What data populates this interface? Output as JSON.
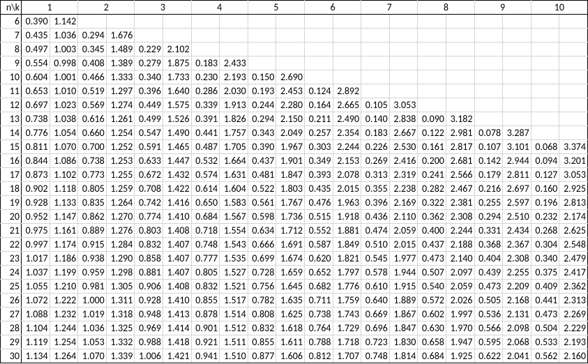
{
  "chart_data": {
    "type": "table",
    "title": "",
    "xlabel": "",
    "ylabel": "",
    "corner_label": "n\\k",
    "k_headers": [
      "1",
      "2",
      "3",
      "4",
      "5",
      "6",
      "7",
      "8",
      "9",
      "10"
    ],
    "n_values": [
      6,
      7,
      8,
      9,
      10,
      11,
      12,
      13,
      14,
      15,
      16,
      17,
      18,
      19,
      20,
      21,
      22,
      23,
      24,
      25,
      26,
      27,
      28,
      29,
      30
    ],
    "rows": [
      {
        "n": "6",
        "cells": [
          "0.390",
          "1.142",
          "",
          "",
          "",
          "",
          "",
          "",
          "",
          "",
          "",
          "",
          "",
          "",
          "",
          "",
          "",
          "",
          "",
          ""
        ]
      },
      {
        "n": "7",
        "cells": [
          "0.435",
          "1.036",
          "0.294",
          "1.676",
          "",
          "",
          "",
          "",
          "",
          "",
          "",
          "",
          "",
          "",
          "",
          "",
          "",
          "",
          "",
          ""
        ]
      },
      {
        "n": "8",
        "cells": [
          "0.497",
          "1.003",
          "0.345",
          "1.489",
          "0.229",
          "2.102",
          "",
          "",
          "",
          "",
          "",
          "",
          "",
          "",
          "",
          "",
          "",
          "",
          "",
          ""
        ]
      },
      {
        "n": "9",
        "cells": [
          "0.554",
          "0.998",
          "0.408",
          "1.389",
          "0.279",
          "1.875",
          "0.183",
          "2.433",
          "",
          "",
          "",
          "",
          "",
          "",
          "",
          "",
          "",
          "",
          "",
          ""
        ]
      },
      {
        "n": "10",
        "cells": [
          "0.604",
          "1.001",
          "0.466",
          "1.333",
          "0.340",
          "1.733",
          "0.230",
          "2.193",
          "0.150",
          "2.690",
          "",
          "",
          "",
          "",
          "",
          "",
          "",
          "",
          "",
          ""
        ]
      },
      {
        "n": "11",
        "cells": [
          "0.653",
          "1.010",
          "0.519",
          "1.297",
          "0.396",
          "1.640",
          "0.286",
          "2.030",
          "0.193",
          "2.453",
          "0.124",
          "2.892",
          "",
          "",
          "",
          "",
          "",
          "",
          "",
          ""
        ]
      },
      {
        "n": "12",
        "cells": [
          "0.697",
          "1.023",
          "0.569",
          "1.274",
          "0.449",
          "1.575",
          "0.339",
          "1.913",
          "0.244",
          "2.280",
          "0.164",
          "2.665",
          "0.105",
          "3.053",
          "",
          "",
          "",
          "",
          "",
          ""
        ]
      },
      {
        "n": "13",
        "cells": [
          "0.738",
          "1.038",
          "0.616",
          "1.261",
          "0.499",
          "1.526",
          "0.391",
          "1.826",
          "0.294",
          "2.150",
          "0.211",
          "2.490",
          "0.140",
          "2.838",
          "0.090",
          "3.182",
          "",
          "",
          "",
          ""
        ]
      },
      {
        "n": "14",
        "cells": [
          "0.776",
          "1.054",
          "0.660",
          "1.254",
          "0.547",
          "1.490",
          "0.441",
          "1.757",
          "0.343",
          "2.049",
          "0.257",
          "2.354",
          "0.183",
          "2.667",
          "0.122",
          "2.981",
          "0.078",
          "3.287",
          "",
          ""
        ]
      },
      {
        "n": "15",
        "cells": [
          "0.811",
          "1.070",
          "0.700",
          "1.252",
          "0.591",
          "1.465",
          "0.487",
          "1.705",
          "0.390",
          "1.967",
          "0.303",
          "2.244",
          "0.226",
          "2.530",
          "0.161",
          "2.817",
          "0.107",
          "3.101",
          "0.068",
          "3.374"
        ]
      },
      {
        "n": "16",
        "cells": [
          "0.844",
          "1.086",
          "0.738",
          "1.253",
          "0.633",
          "1.447",
          "0.532",
          "1.664",
          "0.437",
          "1.901",
          "0.349",
          "2.153",
          "0.269",
          "2.416",
          "0.200",
          "2.681",
          "0.142",
          "2.944",
          "0.094",
          "3.201"
        ]
      },
      {
        "n": "17",
        "cells": [
          "0.873",
          "1.102",
          "0.773",
          "1.255",
          "0.672",
          "1.432",
          "0.574",
          "1.631",
          "0.481",
          "1.847",
          "0.393",
          "2.078",
          "0.313",
          "2.319",
          "0.241",
          "2.566",
          "0.179",
          "2.811",
          "0.127",
          "3.053"
        ]
      },
      {
        "n": "18",
        "cells": [
          "0.902",
          "1.118",
          "0.805",
          "1.259",
          "0.708",
          "1.422",
          "0.614",
          "1.604",
          "0.522",
          "1.803",
          "0.435",
          "2.015",
          "0.355",
          "2.238",
          "0.282",
          "2.467",
          "0.216",
          "2.697",
          "0.160",
          "2.925"
        ]
      },
      {
        "n": "19",
        "cells": [
          "0.928",
          "1.133",
          "0.835",
          "1.264",
          "0.742",
          "1.416",
          "0.650",
          "1.583",
          "0.561",
          "1.767",
          "0.476",
          "1.963",
          "0.396",
          "2.169",
          "0.322",
          "2.381",
          "0.255",
          "2.597",
          "0.196",
          "2.813"
        ]
      },
      {
        "n": "20",
        "cells": [
          "0.952",
          "1.147",
          "0.862",
          "1.270",
          "0.774",
          "1.410",
          "0.684",
          "1.567",
          "0.598",
          "1.736",
          "0.515",
          "1.918",
          "0.436",
          "2.110",
          "0.362",
          "2.308",
          "0.294",
          "2.510",
          "0.232",
          "2.174"
        ]
      },
      {
        "n": "21",
        "cells": [
          "0.975",
          "1.161",
          "0.889",
          "1.276",
          "0.803",
          "1.408",
          "0.718",
          "1.554",
          "0.634",
          "1.712",
          "0.552",
          "1.881",
          "0.474",
          "2.059",
          "0.400",
          "2.244",
          "0.331",
          "2.434",
          "0.268",
          "2.625"
        ]
      },
      {
        "n": "22",
        "cells": [
          "0.997",
          "1.174",
          "0.915",
          "1.284",
          "0.832",
          "1.407",
          "0.748",
          "1.543",
          "0.666",
          "1.691",
          "0.587",
          "1.849",
          "0.510",
          "2.015",
          "0.437",
          "2.188",
          "0.368",
          "2.367",
          "0.304",
          "2.548"
        ]
      },
      {
        "n": "23",
        "cells": [
          "1.017",
          "1.186",
          "0.938",
          "1.290",
          "0.858",
          "1.407",
          "0.777",
          "1.535",
          "0.699",
          "1.674",
          "0.620",
          "1.821",
          "0.545",
          "1.977",
          "0.473",
          "2.140",
          "0.404",
          "2.308",
          "0.340",
          "2.479"
        ]
      },
      {
        "n": "24",
        "cells": [
          "1.037",
          "1.199",
          "0.959",
          "1.298",
          "0.881",
          "1.407",
          "0.805",
          "1.527",
          "0.728",
          "1.659",
          "0.652",
          "1.797",
          "0.578",
          "1.944",
          "0.507",
          "2.097",
          "0.439",
          "2.255",
          "0.375",
          "2.417"
        ]
      },
      {
        "n": "25",
        "cells": [
          "1.055",
          "1.210",
          "0.981",
          "1.305",
          "0.906",
          "1.408",
          "0.832",
          "1.521",
          "0.756",
          "1.645",
          "0.682",
          "1.776",
          "0.610",
          "1.915",
          "0.540",
          "2.059",
          "0.473",
          "2.209",
          "0.409",
          "2.362"
        ]
      },
      {
        "n": "26",
        "cells": [
          "1.072",
          "1.222",
          "1.000",
          "1.311",
          "0.928",
          "1.410",
          "0.855",
          "1.517",
          "0.782",
          "1.635",
          "0.711",
          "1.759",
          "0.640",
          "1.889",
          "0.572",
          "2.026",
          "0.505",
          "2.168",
          "0.441",
          "2.313"
        ]
      },
      {
        "n": "27",
        "cells": [
          "1.088",
          "1.232",
          "1.019",
          "1.318",
          "0.948",
          "1.413",
          "0.878",
          "1.514",
          "0.808",
          "1.625",
          "0.738",
          "1.743",
          "0.669",
          "1.867",
          "0.602",
          "1.997",
          "0.536",
          "2.131",
          "0.473",
          "2.269"
        ]
      },
      {
        "n": "28",
        "cells": [
          "1.104",
          "1.244",
          "1.036",
          "1.325",
          "0.969",
          "1.414",
          "0.901",
          "1.512",
          "0.832",
          "1.618",
          "0.764",
          "1.729",
          "0.696",
          "1.847",
          "0.630",
          "1.970",
          "0.566",
          "2.098",
          "0.504",
          "2.229"
        ]
      },
      {
        "n": "29",
        "cells": [
          "1.119",
          "1.254",
          "1.053",
          "1.332",
          "0.988",
          "1.418",
          "0.921",
          "1.511",
          "0.855",
          "1.611",
          "0.788",
          "1.718",
          "0.723",
          "1.830",
          "0.658",
          "1.947",
          "0.595",
          "2.068",
          "0.533",
          "2.193"
        ]
      },
      {
        "n": "30",
        "cells": [
          "1.134",
          "1.264",
          "1.070",
          "1.339",
          "1.006",
          "1.421",
          "0.941",
          "1.510",
          "0.877",
          "1.606",
          "0.812",
          "1.707",
          "0.748",
          "1.814",
          "0.684",
          "1.925",
          "0.622",
          "2.041",
          "0.562",
          "2.160"
        ]
      }
    ]
  }
}
